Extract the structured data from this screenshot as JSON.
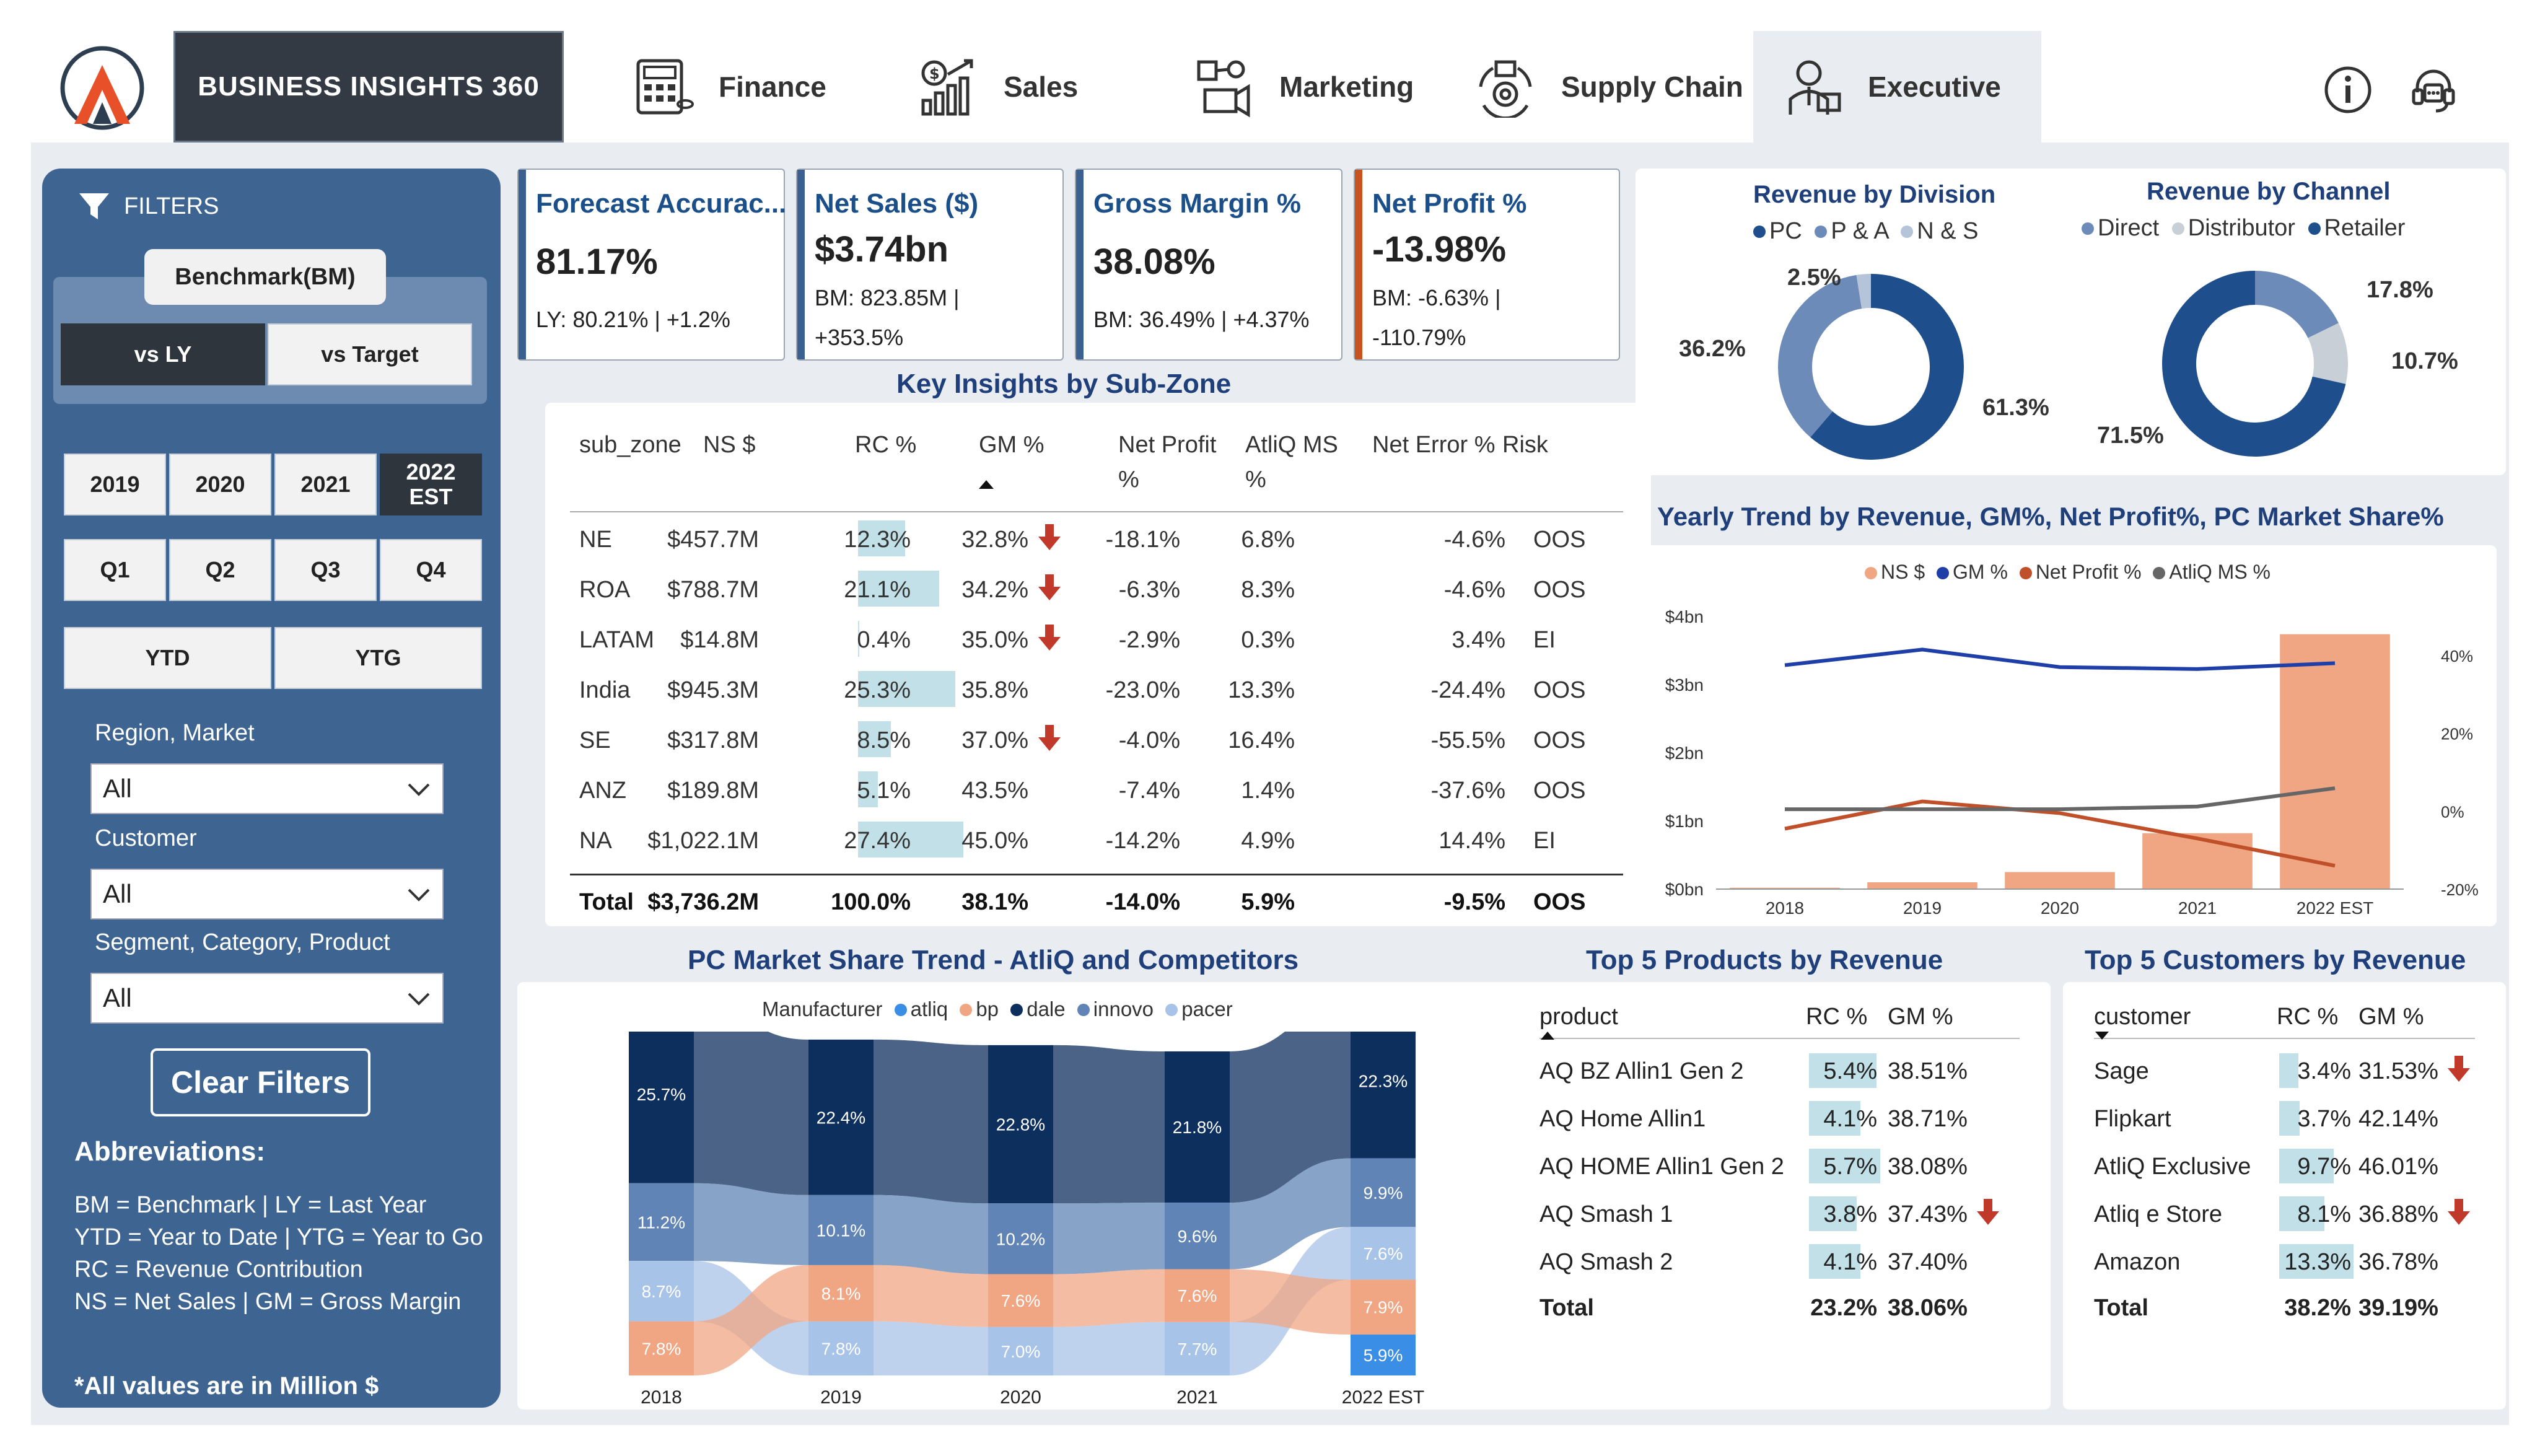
{
  "nav": {
    "brand": "BUSINESS INSIGHTS 360",
    "tabs": [
      "Finance",
      "Sales",
      "Marketing",
      "Supply Chain",
      "Executive"
    ],
    "active_tab": "Executive"
  },
  "filters": {
    "title": "FILTERS",
    "benchmark_label": "Benchmark(BM)",
    "vs_ly": "vs LY",
    "vs_target": "vs Target",
    "years": [
      "2019",
      "2020",
      "2021",
      "2022\nEST"
    ],
    "quarters": [
      "Q1",
      "Q2",
      "Q3",
      "Q4"
    ],
    "ytd": "YTD",
    "ytg": "YTG",
    "region_label": "Region, Market",
    "region_value": "All",
    "customer_label": "Customer",
    "customer_value": "All",
    "segment_label": "Segment, Category, Product",
    "segment_value": "All",
    "clear_filters": "Clear Filters",
    "abbr_title": "Abbreviations:",
    "abbr_lines": [
      "BM = Benchmark | LY = Last Year",
      "YTD = Year to Date | YTG = Year to Go",
      "RC = Revenue Contribution",
      "NS = Net Sales | GM = Gross Margin"
    ],
    "note": "*All values are in Million $"
  },
  "kpis": [
    {
      "title": "Forecast Accurac...",
      "value": "81.17%",
      "sub1": "LY: 80.21% | +1.2%",
      "sub2": "",
      "color": "#3b5f8e"
    },
    {
      "title": "Net Sales ($)",
      "value": "$3.74bn",
      "sub1": "BM: 823.85M |",
      "sub2": "+353.5%",
      "color": "#3b5f8e"
    },
    {
      "title": "Gross Margin %",
      "value": "38.08%",
      "sub1": "BM: 36.49% | +4.37%",
      "sub2": "",
      "color": "#3b5f8e"
    },
    {
      "title": "Net Profit %",
      "value": "-13.98%",
      "sub1": "BM: -6.63% |",
      "sub2": "-110.79%",
      "color": "#c8531f"
    }
  ],
  "insights": {
    "title": "Key Insights by Sub-Zone",
    "headers": [
      "sub_zone",
      "NS $",
      "RC %",
      "GM %",
      "Net Profit\n%",
      "AtliQ MS\n%",
      "Net Error %",
      "Risk"
    ],
    "rows": [
      {
        "zone": "NE",
        "ns": "$457.7M",
        "rc": "12.3%",
        "rcv": 12.3,
        "gm": "32.8%",
        "down": true,
        "np": "-18.1%",
        "ms": "6.8%",
        "ne": "-4.6%",
        "risk": "OOS"
      },
      {
        "zone": "ROA",
        "ns": "$788.7M",
        "rc": "21.1%",
        "rcv": 21.1,
        "gm": "34.2%",
        "down": true,
        "np": "-6.3%",
        "ms": "8.3%",
        "ne": "-4.6%",
        "risk": "OOS"
      },
      {
        "zone": "LATAM",
        "ns": "$14.8M",
        "rc": "0.4%",
        "rcv": 0.4,
        "gm": "35.0%",
        "down": true,
        "np": "-2.9%",
        "ms": "0.3%",
        "ne": "3.4%",
        "risk": "EI"
      },
      {
        "zone": "India",
        "ns": "$945.3M",
        "rc": "25.3%",
        "rcv": 25.3,
        "gm": "35.8%",
        "down": false,
        "np": "-23.0%",
        "ms": "13.3%",
        "ne": "-24.4%",
        "risk": "OOS"
      },
      {
        "zone": "SE",
        "ns": "$317.8M",
        "rc": "8.5%",
        "rcv": 8.5,
        "gm": "37.0%",
        "down": true,
        "np": "-4.0%",
        "ms": "16.4%",
        "ne": "-55.5%",
        "risk": "OOS"
      },
      {
        "zone": "ANZ",
        "ns": "$189.8M",
        "rc": "5.1%",
        "rcv": 5.1,
        "gm": "43.5%",
        "down": false,
        "np": "-7.4%",
        "ms": "1.4%",
        "ne": "-37.6%",
        "risk": "OOS"
      },
      {
        "zone": "NA",
        "ns": "$1,022.1M",
        "rc": "27.4%",
        "rcv": 27.4,
        "gm": "45.0%",
        "down": false,
        "np": "-14.2%",
        "ms": "4.9%",
        "ne": "14.4%",
        "risk": "EI"
      }
    ],
    "total": {
      "zone": "Total",
      "ns": "$3,736.2M",
      "rc": "100.0%",
      "gm": "38.1%",
      "np": "-14.0%",
      "ms": "5.9%",
      "ne": "-9.5%",
      "risk": "OOS"
    }
  },
  "revenue_by_division": {
    "title": "Revenue by Division",
    "legend": [
      "PC",
      "P & A",
      "N & S"
    ],
    "labels": [
      "61.3%",
      "36.2%",
      "2.5%"
    ]
  },
  "revenue_by_channel": {
    "title": "Revenue by Channel",
    "legend": [
      "Direct",
      "Distributor",
      "Retailer"
    ],
    "labels": [
      "71.5%",
      "17.8%",
      "10.7%"
    ]
  },
  "yearly_trend": {
    "title": "Yearly Trend by Revenue, GM%, Net Profit%, PC Market Share%",
    "legend": [
      "NS $",
      "GM %",
      "Net Profit %",
      "AtliQ MS %"
    ],
    "y_left": [
      "$4bn",
      "$3bn",
      "$2bn",
      "$1bn",
      "$0bn"
    ],
    "y_right": [
      "40%",
      "20%",
      "0%",
      "-20%"
    ],
    "x": [
      "2018",
      "2019",
      "2020",
      "2021",
      "2022 EST"
    ]
  },
  "market_share": {
    "title": "PC Market Share Trend - AtliQ and Competitors",
    "legend_label": "Manufacturer",
    "legend": [
      "atliq",
      "bp",
      "dale",
      "innovo",
      "pacer"
    ],
    "x": [
      "2018",
      "2019",
      "2020",
      "2021",
      "2022 EST"
    ],
    "labels_dale": [
      "25.7%",
      "22.4%",
      "22.8%",
      "21.8%",
      "22.3%"
    ],
    "labels_innovo": [
      "11.2%",
      "10.1%",
      "10.2%",
      "9.6%",
      "9.9%"
    ],
    "labels_pacer": [
      "8.7%",
      "7.8%",
      "7.0%",
      "7.7%",
      "7.6%"
    ],
    "labels_bp": [
      "7.8%",
      "8.1%",
      "7.6%",
      "7.6%",
      "7.9%"
    ],
    "labels_atliq": [
      "5.9%"
    ]
  },
  "top_products": {
    "title": "Top 5 Products by Revenue",
    "headers": [
      "product",
      "RC %",
      "GM %"
    ],
    "rows": [
      {
        "name": "AQ BZ Allin1 Gen 2",
        "rc": "5.4%",
        "rcv": 5.4,
        "gm": "38.51%",
        "down": false
      },
      {
        "name": "AQ Home Allin1",
        "rc": "4.1%",
        "rcv": 4.1,
        "gm": "38.71%",
        "down": false
      },
      {
        "name": "AQ HOME Allin1 Gen 2",
        "rc": "5.7%",
        "rcv": 5.7,
        "gm": "38.08%",
        "down": false
      },
      {
        "name": "AQ Smash 1",
        "rc": "3.8%",
        "rcv": 3.8,
        "gm": "37.43%",
        "down": true
      },
      {
        "name": "AQ Smash 2",
        "rc": "4.1%",
        "rcv": 4.1,
        "gm": "37.40%",
        "down": false
      }
    ],
    "total": {
      "name": "Total",
      "rc": "23.2%",
      "gm": "38.06%"
    }
  },
  "top_customers": {
    "title": "Top 5 Customers by Revenue",
    "headers": [
      "customer",
      "RC %",
      "GM %"
    ],
    "rows": [
      {
        "name": "Sage",
        "rc": "3.4%",
        "rcv": 3.4,
        "gm": "31.53%",
        "down": true
      },
      {
        "name": "Flipkart",
        "rc": "3.7%",
        "rcv": 3.7,
        "gm": "42.14%",
        "down": false
      },
      {
        "name": "AtliQ Exclusive",
        "rc": "9.7%",
        "rcv": 9.7,
        "gm": "46.01%",
        "down": false
      },
      {
        "name": "Atliq e Store",
        "rc": "8.1%",
        "rcv": 8.1,
        "gm": "36.88%",
        "down": true
      },
      {
        "name": "Amazon",
        "rc": "13.3%",
        "rcv": 13.3,
        "gm": "36.78%",
        "down": false
      }
    ],
    "total": {
      "name": "Total",
      "rc": "38.2%",
      "gm": "39.19%"
    }
  },
  "chart_data": [
    {
      "type": "pie",
      "title": "Revenue by Division",
      "categories": [
        "PC",
        "P & A",
        "N & S"
      ],
      "values": [
        61.3,
        36.2,
        2.5
      ]
    },
    {
      "type": "pie",
      "title": "Revenue by Channel",
      "categories": [
        "Retailer",
        "Direct",
        "Distributor"
      ],
      "values": [
        71.5,
        17.8,
        10.7
      ]
    },
    {
      "type": "bar",
      "title": "Yearly Trend by Revenue, GM%, Net Profit%, PC Market Share%",
      "categories": [
        "2018",
        "2019",
        "2020",
        "2021",
        "2022 EST"
      ],
      "series": [
        {
          "name": "NS $",
          "values": [
            0.02,
            0.1,
            0.25,
            0.82,
            3.74
          ]
        },
        {
          "name": "GM %",
          "values": [
            37.5,
            41.5,
            37.0,
            36.5,
            38.0
          ]
        },
        {
          "name": "Net Profit %",
          "values": [
            -4.5,
            2.5,
            -0.5,
            -7.0,
            -14.0
          ]
        },
        {
          "name": "AtliQ MS %",
          "values": [
            0.5,
            0.5,
            0.5,
            1.2,
            5.9
          ]
        }
      ],
      "ylim": [
        0,
        4
      ],
      "y2lim": [
        -20,
        50
      ]
    },
    {
      "type": "area",
      "title": "PC Market Share Trend - AtliQ and Competitors",
      "categories": [
        "2018",
        "2019",
        "2020",
        "2021",
        "2022 EST"
      ],
      "series": [
        {
          "name": "dale",
          "values": [
            25.7,
            22.4,
            22.8,
            21.8,
            22.3
          ]
        },
        {
          "name": "innovo",
          "values": [
            11.2,
            10.1,
            10.2,
            9.6,
            9.9
          ]
        },
        {
          "name": "pacer",
          "values": [
            8.7,
            7.8,
            7.0,
            7.7,
            7.6
          ]
        },
        {
          "name": "bp",
          "values": [
            7.8,
            8.1,
            7.6,
            7.6,
            7.9
          ]
        },
        {
          "name": "atliq",
          "values": [
            null,
            null,
            null,
            null,
            5.9
          ]
        }
      ]
    }
  ],
  "colors": {
    "navy": "#1f4e8c",
    "accent_red": "#c0392b",
    "rc_bar": "#c2e0e7",
    "ns_bar": "#f0a583",
    "panel_bg": "#3e6592"
  }
}
